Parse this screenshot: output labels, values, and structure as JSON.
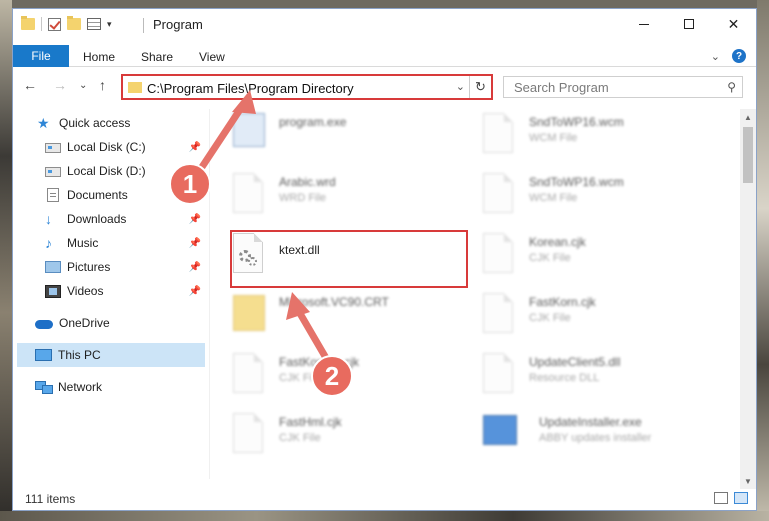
{
  "window": {
    "title": "Program",
    "close_glyph": "✕"
  },
  "ribbon": {
    "file": "File",
    "home": "Home",
    "share": "Share",
    "view": "View",
    "help": "?"
  },
  "address": {
    "path": "C:\\Program Files\\Program Directory",
    "search_placeholder": "Search Program"
  },
  "sidebar": {
    "items": [
      {
        "label": "Quick access",
        "icon": "star-icon"
      },
      {
        "label": "Local Disk (C:)",
        "icon": "drive-icon",
        "pinned": true
      },
      {
        "label": "Local Disk (D:)",
        "icon": "drive-icon"
      },
      {
        "label": "Documents",
        "icon": "document-icon",
        "pinned": true
      },
      {
        "label": "Downloads",
        "icon": "download-icon",
        "pinned": true
      },
      {
        "label": "Music",
        "icon": "music-icon",
        "pinned": true
      },
      {
        "label": "Pictures",
        "icon": "pictures-icon",
        "pinned": true
      },
      {
        "label": "Videos",
        "icon": "videos-icon",
        "pinned": true
      },
      {
        "label": "OneDrive",
        "icon": "cloud-icon"
      },
      {
        "label": "This PC",
        "icon": "computer-icon",
        "selected": true
      },
      {
        "label": "Network",
        "icon": "network-icon"
      }
    ]
  },
  "files": {
    "left": [
      {
        "name": "program.exe",
        "type": ""
      },
      {
        "name": "Arabic.wrd",
        "type": "WRD File"
      },
      {
        "name": "ktext.dll",
        "type": ""
      },
      {
        "name": "Microsoft.VC90.CRT",
        "type": ""
      },
      {
        "name": "FastKorean.cjk",
        "type": "CJK File"
      },
      {
        "name": "FastHml.cjk",
        "type": "CJK File"
      }
    ],
    "right": [
      {
        "name": "SndToWP16.wcm",
        "type": "WCM File"
      },
      {
        "name": "SndToWP16.wcm",
        "type": "WCM File"
      },
      {
        "name": "Korean.cjk",
        "type": "CJK File"
      },
      {
        "name": "FastKorn.cjk",
        "type": "CJK File"
      },
      {
        "name": "UpdateClient5.dll",
        "type": "Resource DLL"
      },
      {
        "name": "UpdateInstaller.exe",
        "type": "ABBY updates installer"
      }
    ]
  },
  "status": {
    "count": "111 items"
  },
  "annotations": {
    "step1": "1",
    "step2": "2"
  },
  "colors": {
    "accent": "#1979ca",
    "highlight": "#d83a3a",
    "selected": "#cce4f7"
  }
}
